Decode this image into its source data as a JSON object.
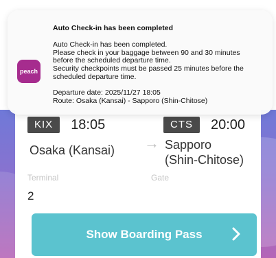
{
  "notification": {
    "app_icon_text": "peach",
    "title": "Auto Check-in has been completed",
    "body_lines": [
      "Auto Check-in has been completed.",
      "Please check in your baggage between 90 and 30 minutes",
      "before the scheduled departure time.",
      "Security checkpoints must be passed 25 minutes before the",
      "scheduled departure time."
    ],
    "departure_date": "Departure date: 2025/11/27 18:05",
    "route": "Route: Osaka (Kansai) - Sapporo (Shin-Chitose)"
  },
  "flight": {
    "departure": {
      "code": "KIX",
      "time": "18:05",
      "city": "Osaka (Kansai)"
    },
    "arrival": {
      "code": "CTS",
      "time": "20:00",
      "city_line1": "Sapporo",
      "city_line2": "(Shin-Chitose)"
    },
    "terminal_label": "Terminal",
    "gate_label": "Gate",
    "terminal_value": "2",
    "gate_value": ""
  },
  "actions": {
    "boarding_pass_label": "Show Boarding Pass"
  },
  "colors": {
    "brand": "#a62c8e",
    "button": "#5bc3cf",
    "code_badge": "#4a4a4a"
  }
}
